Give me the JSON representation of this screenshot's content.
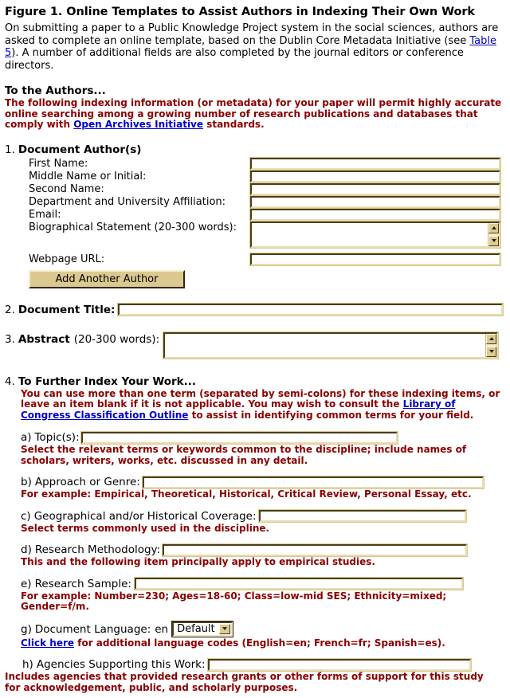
{
  "figure": {
    "title": "Figure 1. Online Templates to Assist Authors in Indexing Their Own Work",
    "intro_part1": "On submitting a paper to a Public Knowledge Project system in the social sciences, authors are asked to complete an online template, based on the Dublin Core Metadata Initiative (see ",
    "intro_link": "Table 5",
    "intro_part2": "). A number of additional fields are also completed by the journal editors or conference directors."
  },
  "to_authors": {
    "heading": "To the Authors...",
    "note_part1": "The following indexing information (or metadata) for your paper will permit highly accurate online searching among a growing number of research publications and databases that comply with ",
    "note_link": "Open Archives Initiative",
    "note_part2": " standards."
  },
  "section1": {
    "number": "1.",
    "title": "Document Author(s)",
    "fields": [
      {
        "label": "First Name:",
        "value": "",
        "type": "text"
      },
      {
        "label": "Middle Name or Initial:",
        "value": "",
        "type": "text"
      },
      {
        "label": "Second Name:",
        "value": "",
        "type": "text"
      },
      {
        "label": "Department and University Affiliation:",
        "value": "",
        "type": "text"
      },
      {
        "label": "Email:",
        "value": "",
        "type": "text"
      },
      {
        "label": "Biographical Statement (20-300 words):",
        "value": "",
        "type": "textarea"
      },
      {
        "label": "Webpage URL:",
        "value": "",
        "type": "text"
      }
    ],
    "add_author_button": "Add Another Author"
  },
  "section2": {
    "number": "2.",
    "title": "Document Title:",
    "value": ""
  },
  "section3": {
    "number": "3.",
    "title": "Abstract",
    "hint": "(20-300 words):",
    "value": ""
  },
  "section4": {
    "number": "4.",
    "title": "To Further Index Your Work...",
    "note_part1": "You can use more than one term (separated by semi-colons) for these indexing items, or leave an item blank if it is not applicable. You may wish to consult the ",
    "note_link": "Library of Congress Classification Outline",
    "note_part2": " to assist in identifying common terms for your field.",
    "items": [
      {
        "key": "a)",
        "label": "Topic(s):",
        "value": "",
        "help": "Select the relevant terms or keywords common to the discipline; include names of scholars, writers, works, etc. discussed in any detail."
      },
      {
        "key": "b)",
        "label": "Approach or Genre:",
        "value": "",
        "help": "For example: Empirical, Theoretical, Historical, Critical Review, Personal Essay, etc."
      },
      {
        "key": "c)",
        "label": "Geographical and/or Historical Coverage:",
        "value": "",
        "help": "Select terms commonly used in the discipline."
      },
      {
        "key": "d)",
        "label": "Research Methodology:",
        "value": "",
        "help": "This and the following item principally apply to empirical studies."
      },
      {
        "key": "e)",
        "label": "Research Sample:",
        "value": "",
        "help": "For example: Number=230; Ages=18-60; Class=low-mid SES; Ethnicity=mixed; Gender=f/m."
      }
    ],
    "language": {
      "key": "g)",
      "label": "Document Language:",
      "code": "en",
      "select_value": "Default",
      "help_link": "Click here",
      "help_rest": " for additional language codes (English=en; French=fr; Spanish=es)."
    },
    "agencies": {
      "key": "h)",
      "label": "Agencies Supporting this Work:",
      "value": "",
      "help": "Includes agencies that provided research grants or other forms of support for this study for acknowledgement, public, and scholarly purposes."
    }
  },
  "colors": {
    "red_note": "#8B0000",
    "link": "#0000CC",
    "field_border_dark": "#4a3d18",
    "field_border_light": "#e8dcb0",
    "button_face": "#dcc98f"
  }
}
